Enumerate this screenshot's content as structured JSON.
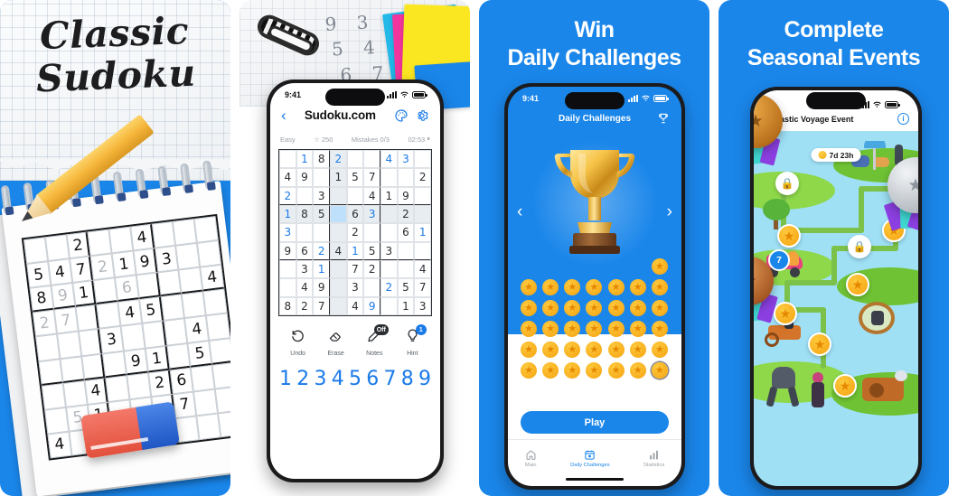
{
  "app": {
    "name": "Classic Sudoku",
    "accent_blue": "#1a86ea",
    "link_blue": "#1a7ae8",
    "star_gold": "#f5a310"
  },
  "panels": [
    {
      "id": "panel-hero-classic-sudoku",
      "title_line1": "Classic",
      "title_line2": "Sudoku",
      "background": "#1a86ea",
      "illustration": "notepad-sudoku-pencil-eraser",
      "puzzle_rows": [
        [
          "",
          "",
          "2",
          "",
          "",
          "4",
          "",
          "",
          ""
        ],
        [
          "5",
          "4",
          "7",
          "2",
          "1",
          "9",
          "3",
          "",
          ""
        ],
        [
          "8",
          "9",
          "1",
          "",
          "6",
          "",
          "",
          "",
          "4"
        ],
        [
          "2",
          "7",
          "",
          "",
          "4",
          "5",
          "",
          "",
          ""
        ],
        [
          "",
          "",
          "",
          "3",
          "",
          "",
          "",
          "4",
          ""
        ],
        [
          "",
          "",
          "",
          "",
          "9",
          "1",
          "",
          "5",
          ""
        ],
        [
          "",
          "",
          "4",
          "",
          "",
          "2",
          "6",
          "",
          ""
        ],
        [
          "",
          "5",
          "1",
          "",
          "",
          "",
          "7",
          "",
          ""
        ],
        [
          "4",
          "",
          "2",
          "3",
          "9",
          "",
          "",
          "",
          ""
        ]
      ],
      "pencil_marks": [
        [
          1,
          3
        ],
        [
          2,
          1
        ],
        [
          2,
          4
        ],
        [
          3,
          0
        ],
        [
          3,
          1
        ],
        [
          7,
          1
        ]
      ]
    },
    {
      "id": "panel-gameplay",
      "desk_notes": [
        "9 3 1",
        "5 4 2",
        "6 7 8"
      ],
      "sticky_note_colors": [
        "#22b8e8",
        "#f2359d",
        "#fbe721",
        "#1a86ea"
      ],
      "status_bar": {
        "time": "9:41"
      },
      "header": {
        "back_label": "‹",
        "brand": "Sudoku.com",
        "icons": [
          "palette-icon",
          "gear-icon"
        ]
      },
      "info_bar": {
        "difficulty": "Easy",
        "score_icon": "☆",
        "score": "250",
        "mistakes": "Mistakes 0/3",
        "timer": "02:53",
        "pause_icon": "⏸"
      },
      "board_rows": [
        [
          "",
          "1",
          "8",
          "2",
          "",
          "",
          "4",
          "3",
          ""
        ],
        [
          "4",
          "9",
          "",
          "1",
          "5",
          "7",
          "",
          "",
          "2"
        ],
        [
          "2",
          "",
          "3",
          "",
          "",
          "4",
          "1",
          "9",
          ""
        ],
        [
          "1",
          "8",
          "5",
          "",
          "6",
          "3",
          "",
          "2",
          ""
        ],
        [
          "3",
          "",
          "",
          "",
          "2",
          "",
          "",
          "6",
          "1"
        ],
        [
          "9",
          "6",
          "2",
          "4",
          "1",
          "5",
          "3",
          "",
          ""
        ],
        [
          "",
          "3",
          "1",
          "",
          "7",
          "2",
          "",
          "",
          "4"
        ],
        [
          "",
          "4",
          "9",
          "",
          "3",
          "",
          "2",
          "5",
          "7"
        ],
        [
          "8",
          "2",
          "7",
          "",
          "4",
          "9",
          "",
          "1",
          "3"
        ]
      ],
      "board_blue_cells": [
        [
          0,
          1
        ],
        [
          0,
          3
        ],
        [
          0,
          6
        ],
        [
          0,
          7
        ],
        [
          2,
          0
        ],
        [
          3,
          0
        ],
        [
          3,
          5
        ],
        [
          4,
          0
        ],
        [
          4,
          8
        ],
        [
          5,
          2
        ],
        [
          5,
          4
        ],
        [
          6,
          2
        ],
        [
          7,
          6
        ],
        [
          8,
          5
        ]
      ],
      "board_highlight_col": 3,
      "board_highlight_row": 3,
      "board_selected_cell": [
        3,
        3
      ],
      "tools": [
        {
          "label": "Undo",
          "icon": "undo-icon",
          "badge": ""
        },
        {
          "label": "Erase",
          "icon": "eraser-icon",
          "badge": ""
        },
        {
          "label": "Notes",
          "icon": "pencil-icon",
          "badge": "Off"
        },
        {
          "label": "Hint",
          "icon": "lightbulb-icon",
          "badge": "1"
        }
      ],
      "numpad": [
        "1",
        "2",
        "3",
        "4",
        "5",
        "6",
        "7",
        "8",
        "9"
      ]
    },
    {
      "id": "panel-daily-challenges",
      "title_line1": "Win",
      "title_line2": "Daily Challenges",
      "status_bar": {
        "time": "9:41"
      },
      "header": {
        "title": "Daily Challenges",
        "trophy_icon": "trophy-icon"
      },
      "carousel": {
        "prev": "‹",
        "next": "›",
        "art": "gold-trophy"
      },
      "stars_total": 36,
      "stars_per_row": 7,
      "current_star_index": 36,
      "play_button": "Play",
      "nav": [
        {
          "label": "Main",
          "icon": "home-icon",
          "active": false
        },
        {
          "label": "Daily Challenges",
          "icon": "calendar-icon",
          "active": true
        },
        {
          "label": "Statistics",
          "icon": "bar-chart-icon",
          "active": false
        }
      ]
    },
    {
      "id": "panel-seasonal-events",
      "title_line1": "Complete",
      "title_line2": "Seasonal Events",
      "event_title": "Fantastic Voyage Event",
      "info_icon": "info-icon",
      "timer": "7d 23h",
      "timer_icon": "clock-icon",
      "level_badge": "7",
      "map_nodes": [
        {
          "type": "lock"
        },
        {
          "type": "lock"
        },
        {
          "type": "star"
        },
        {
          "type": "star"
        },
        {
          "type": "star"
        },
        {
          "type": "star"
        },
        {
          "type": "star"
        },
        {
          "type": "star"
        }
      ],
      "medals": [
        {
          "name": "gold-medal",
          "tier": "bronze"
        },
        {
          "name": "silver-medal",
          "tier": "silver"
        },
        {
          "name": "copper-medal",
          "tier": "copper"
        }
      ]
    }
  ]
}
